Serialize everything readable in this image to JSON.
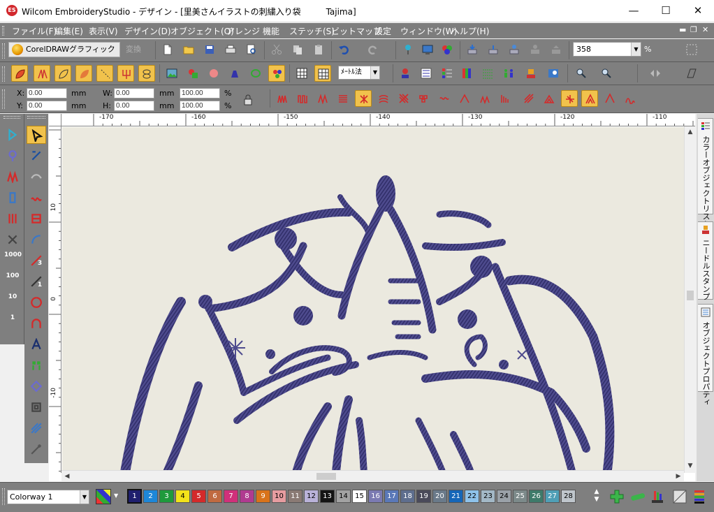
{
  "window": {
    "logo_text": "ES",
    "title": "Wilcom EmbroideryStudio - デザイン - [里美さんイラストの刺繍入り袋　　　Tajima]",
    "minimize": "—",
    "maximize": "☐",
    "close": "✕"
  },
  "menu": {
    "items": [
      "ファイル(F)",
      "編集(E)",
      "表示(V)",
      "デザイン(D)",
      "オブジェクト(O)",
      "アレンジ",
      "機能",
      "ステッチ(S)",
      "ビットマップ",
      "設定",
      "ウィンドウ(W)",
      "ヘルプ(H)"
    ],
    "mdi_minimize": "▬",
    "mdi_restore": "❐",
    "mdi_close": "✕"
  },
  "toolbar": {
    "coreldraw_label": "CorelDRAWグラフィック",
    "convert_label": "変換",
    "zoom_value": "358",
    "zoom_unit": "%",
    "unit_select": "ﾒｰﾄﾙ法"
  },
  "props": {
    "x_label": "X:",
    "x_value": "0.00",
    "x_unit": "mm",
    "y_label": "Y:",
    "y_value": "0.00",
    "y_unit": "mm",
    "w_label": "W:",
    "w_value": "0.00",
    "w_unit": "mm",
    "h_label": "H:",
    "h_value": "0.00",
    "h_unit": "mm",
    "w_scale": "100.00",
    "w_scale_unit": "%",
    "h_scale": "100.00",
    "h_scale_unit": "%"
  },
  "left_numbers": [
    "1000",
    "100",
    "10",
    "1"
  ],
  "left_badges": [
    "3",
    "1"
  ],
  "ruler": {
    "top_labels": [
      "-170",
      "-160",
      "-150",
      "-140",
      "-130",
      "-120",
      "-110"
    ],
    "left_labels": [
      "10",
      "0",
      "-10"
    ]
  },
  "dock_tabs": [
    "カラーオブジェクトリスト",
    "ニードルスタンプ",
    "オブジェクトプロパティ"
  ],
  "colorway": "Colorway 1",
  "swatches": [
    {
      "n": "1",
      "c": "#1f1f6e",
      "t": "#fff"
    },
    {
      "n": "2",
      "c": "#1e87d8",
      "t": "#fff"
    },
    {
      "n": "3",
      "c": "#1f9a3c",
      "t": "#fff"
    },
    {
      "n": "4",
      "c": "#f3e31a",
      "t": "#000"
    },
    {
      "n": "5",
      "c": "#d42a2a",
      "t": "#fff"
    },
    {
      "n": "6",
      "c": "#c06a40",
      "t": "#fff"
    },
    {
      "n": "7",
      "c": "#d0307a",
      "t": "#fff"
    },
    {
      "n": "8",
      "c": "#b03a90",
      "t": "#fff"
    },
    {
      "n": "9",
      "c": "#d9731a",
      "t": "#fff"
    },
    {
      "n": "10",
      "c": "#e69ca0",
      "t": "#000"
    },
    {
      "n": "11",
      "c": "#8a7a74",
      "t": "#fff"
    },
    {
      "n": "12",
      "c": "#b9b2d9",
      "t": "#000"
    },
    {
      "n": "13",
      "c": "#141414",
      "t": "#fff"
    },
    {
      "n": "14",
      "c": "#a2a2a2",
      "t": "#000"
    },
    {
      "n": "15",
      "c": "#ffffff",
      "t": "#000"
    },
    {
      "n": "16",
      "c": "#7b7ab2",
      "t": "#fff"
    },
    {
      "n": "17",
      "c": "#5a78b8",
      "t": "#fff"
    },
    {
      "n": "18",
      "c": "#5e6e8e",
      "t": "#fff"
    },
    {
      "n": "19",
      "c": "#4a4a5a",
      "t": "#fff"
    },
    {
      "n": "20",
      "c": "#6a7a8a",
      "t": "#fff"
    },
    {
      "n": "21",
      "c": "#1566b8",
      "t": "#fff"
    },
    {
      "n": "22",
      "c": "#8ec2ea",
      "t": "#000"
    },
    {
      "n": "23",
      "c": "#a3b8c6",
      "t": "#000"
    },
    {
      "n": "24",
      "c": "#9aa1a8",
      "t": "#000"
    },
    {
      "n": "25",
      "c": "#7c8a8a",
      "t": "#fff"
    },
    {
      "n": "26",
      "c": "#3e7a6a",
      "t": "#fff"
    },
    {
      "n": "27",
      "c": "#4f9fb6",
      "t": "#fff"
    },
    {
      "n": "28",
      "c": "#bfc6cc",
      "t": "#000"
    }
  ],
  "selected_swatch": "1",
  "thread_color": "#4c4a8c"
}
